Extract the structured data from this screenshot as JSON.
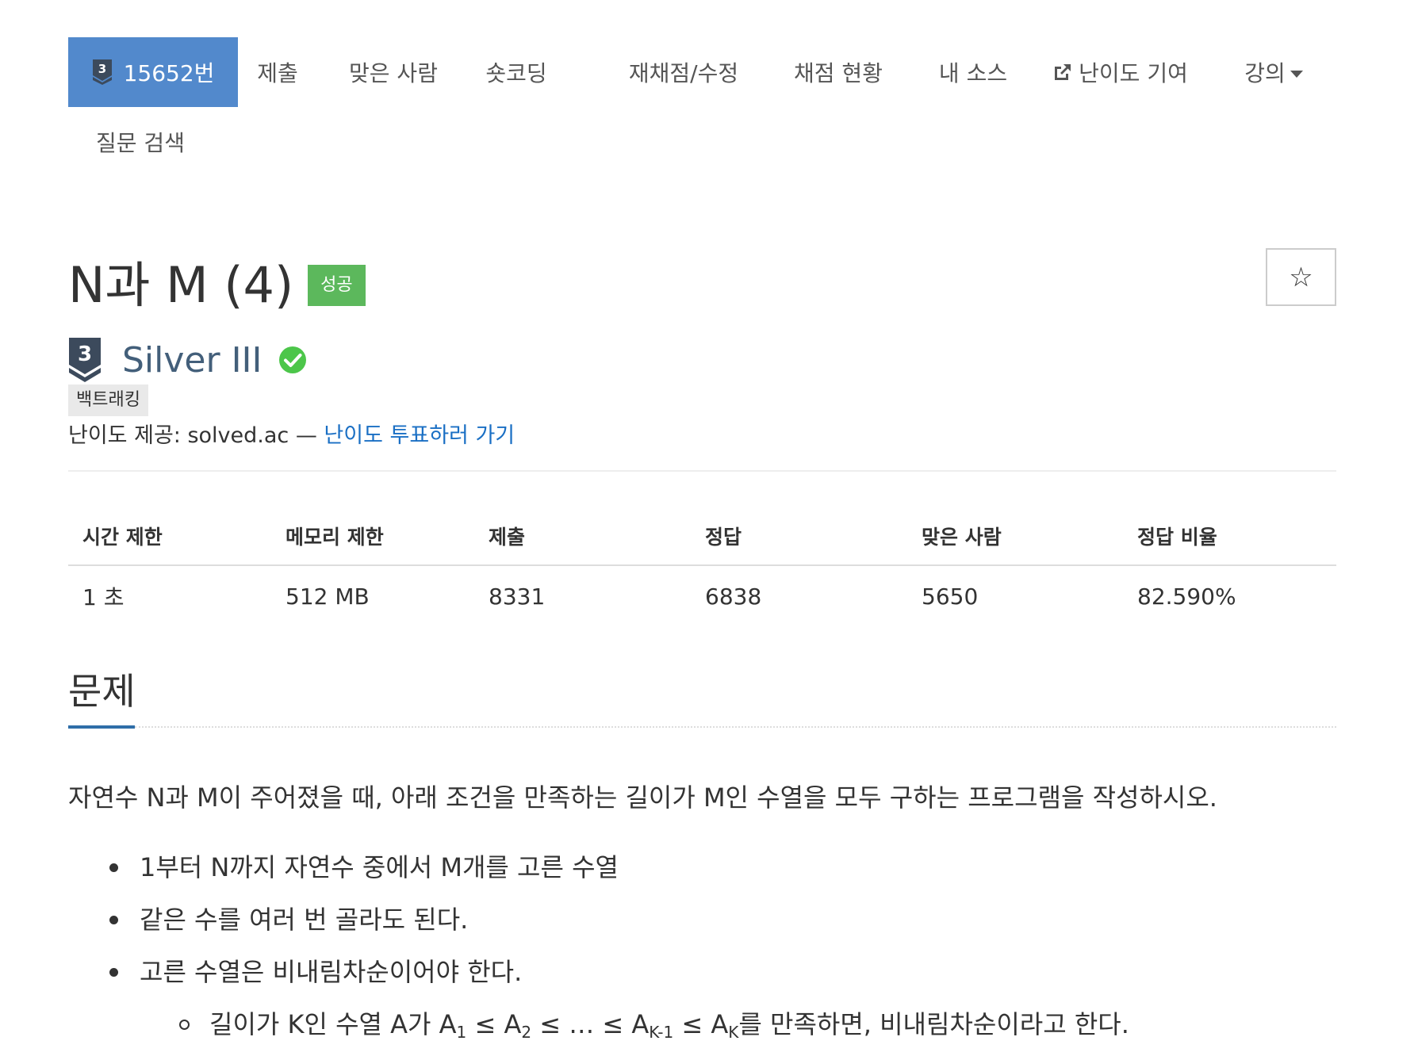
{
  "nav": {
    "problem_tier_digit": "3",
    "problem_number": "15652번",
    "submit": "제출",
    "accepted_people": "맞은 사람",
    "shortest_code": "숏코딩",
    "rejudge": "재채점/수정",
    "status": "채점 현황",
    "my_source": "내 소스",
    "difficulty_contribution": "난이도 기여",
    "lectures": "강의",
    "question_search": "질문 검색",
    "active_color": "#5289cc"
  },
  "problem": {
    "title": "N과 M (4)",
    "result_badge": "성공",
    "star": "☆",
    "tier_digit": "3",
    "tier_name": "Silver III",
    "tag": "백트래킹",
    "difficulty_source_prefix": "난이도 제공: solved.ac — ",
    "difficulty_vote_link": "난이도 투표하러 가기"
  },
  "stats": {
    "headers": [
      "시간 제한",
      "메모리 제한",
      "제출",
      "정답",
      "맞은 사람",
      "정답 비율"
    ],
    "values": [
      "1 초",
      "512 MB",
      "8331",
      "6838",
      "5650",
      "82.590%"
    ]
  },
  "section": {
    "heading": "문제",
    "description": "자연수 N과 M이 주어졌을 때, 아래 조건을 만족하는 길이가 M인 수열을 모두 구하는 프로그램을 작성하시오.",
    "bullets": [
      "1부터 N까지 자연수 중에서 M개를 고른 수열",
      "같은 수를 여러 번 골라도 된다.",
      "고른 수열은 비내림차순이어야 한다."
    ],
    "sub_bullet": {
      "intro": "길이가 K인 수열 A가 A",
      "sub1": "1",
      "le1": " ≤ A",
      "sub2": "2",
      "le2": " ≤ … ≤ A",
      "sub3": "K-1",
      "le3": " ≤ A",
      "sub4": "K",
      "outro": "를 만족하면, 비내림차순이라고 한다."
    }
  },
  "colors": {
    "success_badge": "#5cb85c",
    "tier_silver": "#435f7a",
    "link": "#1a6fc4",
    "section_underline": "#2f6ea8"
  }
}
